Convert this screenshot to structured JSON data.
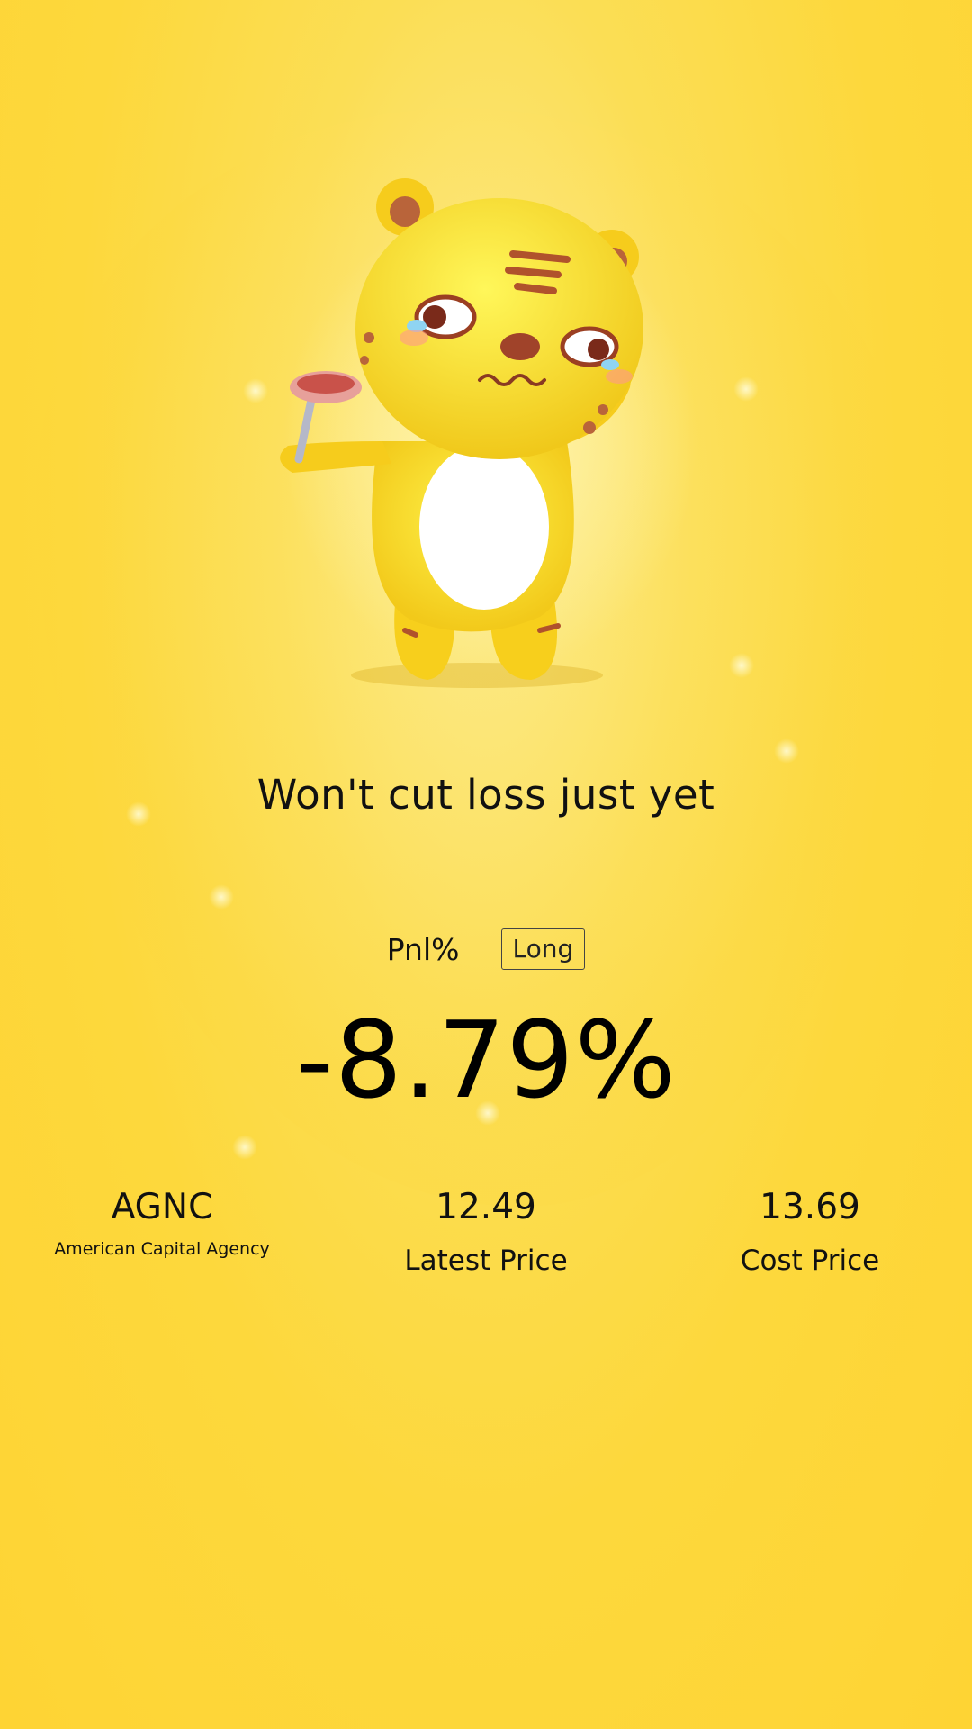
{
  "headline": "Won't cut loss just yet",
  "pnl": {
    "label": "Pnl%",
    "direction": "Long",
    "value": "-8.79%"
  },
  "stock": {
    "symbol": "AGNC",
    "name": "American Capital Agency"
  },
  "latest": {
    "value": "12.49",
    "label": "Latest Price"
  },
  "cost": {
    "value": "13.69",
    "label": "Cost Price"
  },
  "mascot": {
    "icon": "tiger-mascot-icon"
  },
  "colors": {
    "background": "#fdd83c",
    "text": "#111111"
  }
}
